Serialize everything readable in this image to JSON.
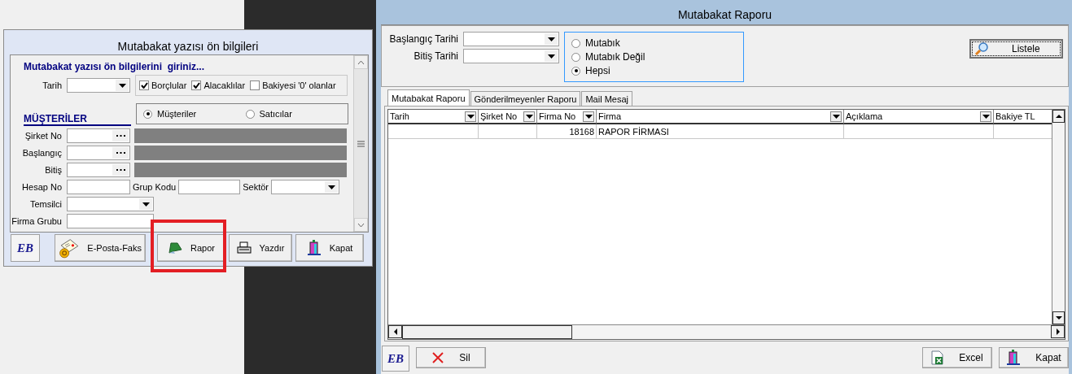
{
  "dialog": {
    "title": "Mutabakat yazısı ön bilgileri",
    "heading": "Mutabakat yazısı ön bilgilerini  giriniz...",
    "date_label": "Tarih",
    "checkboxes": [
      {
        "label": "Borçlular",
        "checked": true
      },
      {
        "label": "Alacaklılar",
        "checked": true
      },
      {
        "label": "Bakiyesi  '0' olanlar",
        "checked": false
      }
    ],
    "section_heading": "MÜŞTERİLER",
    "party_options": [
      {
        "label": "Müşteriler",
        "selected": true
      },
      {
        "label": "Satıcılar",
        "selected": false
      }
    ],
    "lookup_fields": [
      {
        "label": "Şirket No"
      },
      {
        "label": "Başlangıç"
      },
      {
        "label": "Bitiş"
      }
    ],
    "account_label": "Hesap No",
    "group_code_label": "Grup Kodu",
    "sector_label": "Sektör",
    "rep_label": "Temsilci",
    "company_group_label": "Firma Grubu",
    "logo": "EB",
    "buttons": [
      {
        "label": "E-Posta-Faks",
        "kind": "mail",
        "highlighted": false
      },
      {
        "label": "Rapor",
        "kind": "book",
        "highlighted": true
      },
      {
        "label": "Yazdır",
        "kind": "printer",
        "highlighted": false
      },
      {
        "label": "Kapat",
        "kind": "exit",
        "highlighted": false
      }
    ]
  },
  "report_window": {
    "title": "Mutabakat Raporu",
    "start_label": "Başlangıç Tarihi",
    "end_label": "Bitiş Tarihi",
    "status_options": [
      {
        "label": "Mutabık",
        "selected": false
      },
      {
        "label": "Mutabık Değil",
        "selected": false
      },
      {
        "label": "Hepsi",
        "selected": true
      }
    ],
    "list_button": "Listele",
    "tabs": [
      {
        "label": "Mutabakat Raporu",
        "selected": true
      },
      {
        "label": "Gönderilmeyenler Raporu",
        "selected": false
      },
      {
        "label": "Mail Mesaj",
        "selected": false
      }
    ],
    "table": {
      "columns": [
        {
          "label": "Tarih",
          "filter": true
        },
        {
          "label": "Şirket No",
          "filter": true
        },
        {
          "label": "Firma No",
          "filter": true
        },
        {
          "label": "Firma",
          "filter": true
        },
        {
          "label": "Açıklama",
          "filter": true
        },
        {
          "label": "Bakiye TL",
          "filter": false
        }
      ],
      "rows": [
        [
          "",
          "",
          "18168",
          "RAPOR FİRMASI",
          "",
          ""
        ]
      ]
    },
    "logo": "EB",
    "buttons": [
      {
        "label": "Sil",
        "kind": "delete"
      },
      {
        "label": "Excel",
        "kind": "excel"
      },
      {
        "label": "Kapat",
        "kind": "exit"
      }
    ]
  }
}
